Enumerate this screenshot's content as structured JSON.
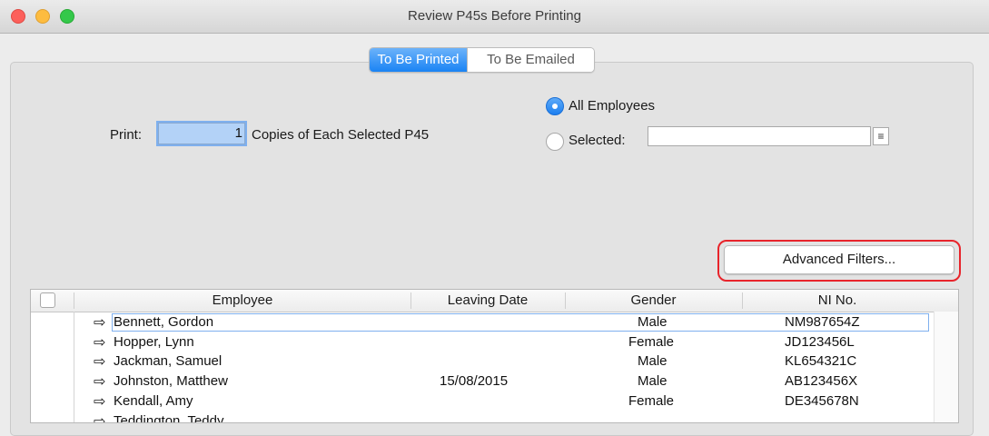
{
  "window": {
    "title": "Review P45s Before Printing"
  },
  "tabs": {
    "to_be_printed": "To Be Printed",
    "to_be_emailed": "To Be Emailed"
  },
  "print_options": {
    "print_label": "Print:",
    "copies_value": "1",
    "copies_suffix": "Copies of Each Selected P45"
  },
  "employee_filter": {
    "all_label": "All Employees",
    "selected_label": "Selected:",
    "selected_value": "",
    "selected_option": "all"
  },
  "advanced_filters_label": "Advanced Filters...",
  "table": {
    "columns": [
      "Employee",
      "Leaving Date",
      "Gender",
      "NI No."
    ],
    "rows": [
      {
        "employee": "Bennett, Gordon",
        "leaving_date": "",
        "gender": "Male",
        "ni": "NM987654Z"
      },
      {
        "employee": "Hopper, Lynn",
        "leaving_date": "",
        "gender": "Female",
        "ni": "JD123456L"
      },
      {
        "employee": "Jackman, Samuel",
        "leaving_date": "",
        "gender": "Male",
        "ni": "KL654321C"
      },
      {
        "employee": "Johnston, Matthew",
        "leaving_date": "15/08/2015",
        "gender": "Male",
        "ni": "AB123456X"
      },
      {
        "employee": "Kendall, Amy",
        "leaving_date": "",
        "gender": "Female",
        "ni": "DE345678N"
      },
      {
        "employee": "Teddington, Teddy",
        "leaving_date": "",
        "gender": "",
        "ni": ""
      }
    ]
  },
  "colors": {
    "accent": "#1a83f4",
    "highlight": "#e8242b"
  }
}
